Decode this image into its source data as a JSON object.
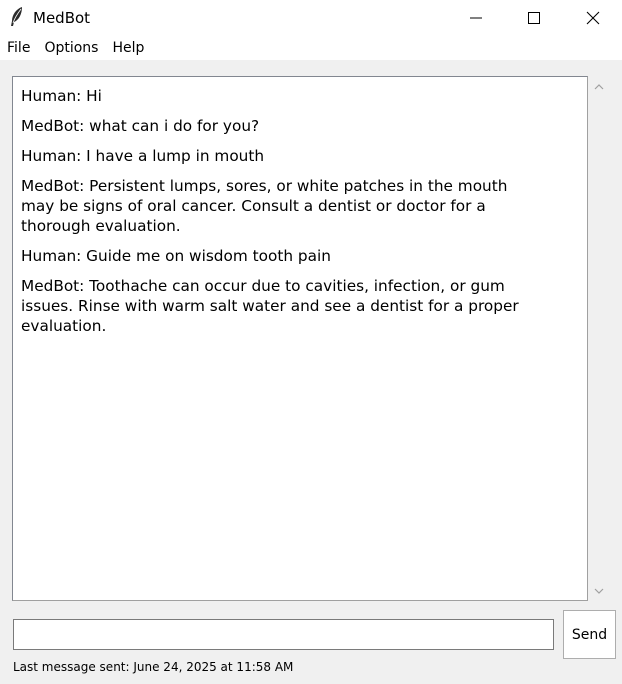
{
  "window": {
    "title": "MedBot",
    "app_icon": "feather-icon"
  },
  "menu": {
    "items": [
      {
        "label": "File"
      },
      {
        "label": "Options"
      },
      {
        "label": "Help"
      }
    ]
  },
  "chat": {
    "messages": [
      {
        "sender": "Human",
        "text": "Human: Hi"
      },
      {
        "sender": "MedBot",
        "text": "MedBot: what can i do for you?"
      },
      {
        "sender": "Human",
        "text": "Human: I have a lump in mouth"
      },
      {
        "sender": "MedBot",
        "text": "MedBot: Persistent lumps, sores, or white patches in the mouth\nmay be signs of oral cancer. Consult a dentist or doctor for a\nthorough evaluation."
      },
      {
        "sender": "Human",
        "text": "Human: Guide me on wisdom tooth pain"
      },
      {
        "sender": "MedBot",
        "text": "MedBot: Toothache can occur due to cavities, infection, or gum\nissues. Rinse with warm salt water and see a dentist for a proper\nevaluation."
      }
    ]
  },
  "input": {
    "value": "",
    "placeholder": ""
  },
  "send_button": {
    "label": "Send"
  },
  "status": {
    "text": "Last message sent: June 24, 2025 at 11:58 AM"
  }
}
